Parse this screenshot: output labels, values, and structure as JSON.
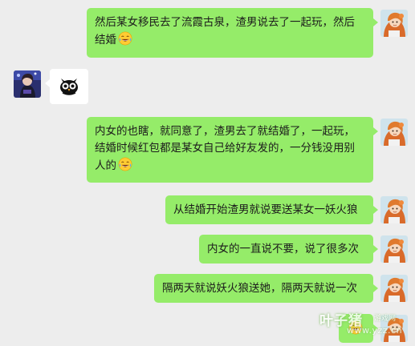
{
  "messages": [
    {
      "side": "out",
      "text": "然后某女移民去了流霞古泉，渣男说去了一起玩，然后结婚",
      "emoji": "laugh-cry-emoji"
    },
    {
      "side": "in",
      "sticker": "owl-sticker"
    },
    {
      "side": "out",
      "text": "内女的也瞎，就同意了，渣男去了就结婚了，一起玩，结婚时候红包都是某女自己给好友发的，一分钱没用别人的",
      "emoji": "laugh-cry-emoji"
    },
    {
      "side": "out",
      "text": "从结婚开始渣男就说要送某女一妖火狼"
    },
    {
      "side": "out",
      "text": "内女的一直说不要，说了很多次"
    },
    {
      "side": "out",
      "text": "隔两天就说妖火狼送她，隔两天就说一次"
    },
    {
      "side": "out",
      "emoji": "laugh-cry-emoji"
    }
  ],
  "watermark": {
    "brand": "叶子猪",
    "sub": "游戏网",
    "url": "www.yzz.cn"
  },
  "colors": {
    "background": "#ededed",
    "outgoing_bubble": "#95ec69",
    "incoming_bubble": "#ffffff"
  }
}
